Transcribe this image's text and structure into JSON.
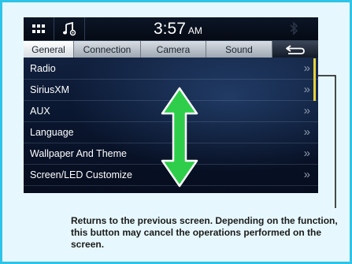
{
  "status_bar": {
    "time": "3:57",
    "ampm": "AM",
    "menu_icon": "grid-menu-icon",
    "audio_icon": "music-note-settings-icon",
    "bluetooth_icon": "bluetooth-icon"
  },
  "tabs": [
    {
      "label": "General",
      "active": true
    },
    {
      "label": "Connection",
      "active": false
    },
    {
      "label": "Camera",
      "active": false
    },
    {
      "label": "Sound",
      "active": false
    }
  ],
  "back_button": {
    "icon": "back-arrow-icon"
  },
  "menu_items": [
    {
      "label": "Radio"
    },
    {
      "label": "SiriusXM"
    },
    {
      "label": "AUX"
    },
    {
      "label": "Language"
    },
    {
      "label": "Wallpaper And Theme"
    },
    {
      "label": "Screen/LED Customize"
    }
  ],
  "chevron": "»",
  "callout": {
    "text": "Returns to the previous screen. Depending on the function, this button may cancel the operations performed on the screen."
  },
  "colors": {
    "frame": "#2ec4e8",
    "frame_bg": "#e6f8fd",
    "arrow": "#2fce4a",
    "scroll": "#e8d23a"
  }
}
